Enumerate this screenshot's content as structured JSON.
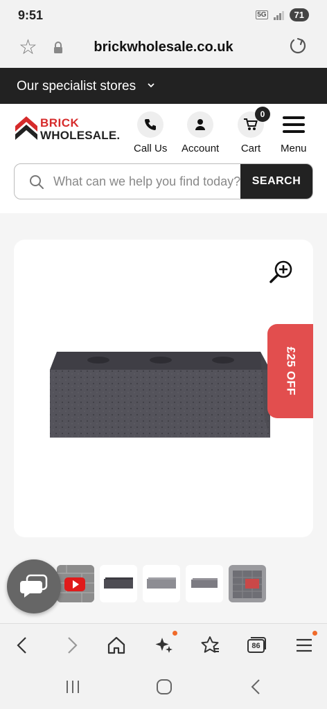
{
  "status_bar": {
    "time": "9:51",
    "network": "5G",
    "battery": "71"
  },
  "browser": {
    "url": "brickwholesale.co.uk"
  },
  "stores_bar": {
    "label": "Our specialist stores"
  },
  "logo": {
    "line1": "BRICK",
    "line2": "WHOLESALE."
  },
  "header": {
    "call_label": "Call Us",
    "account_label": "Account",
    "cart_label": "Cart",
    "cart_count": "0",
    "menu_label": "Menu"
  },
  "search": {
    "placeholder": "What can we help you find today?",
    "button_label": "SEARCH"
  },
  "product": {
    "promo": "£25 OFF"
  },
  "browser_nav": {
    "tabs_count": "86"
  },
  "colors": {
    "brand_red": "#d62b2b",
    "promo_red": "#e24e4e",
    "dark": "#222222",
    "notify_orange": "#f06a2a"
  }
}
